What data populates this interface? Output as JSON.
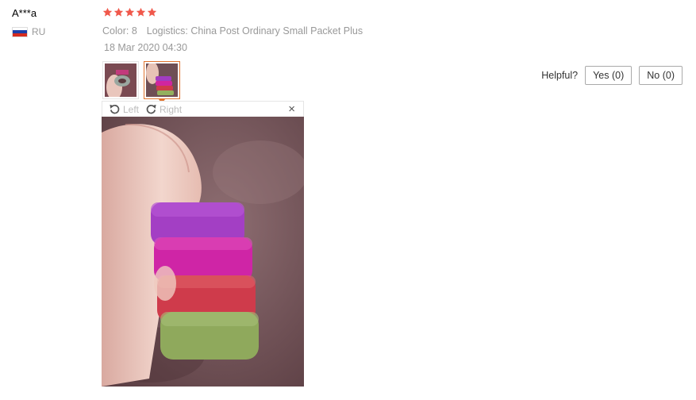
{
  "review": {
    "buyer_name": "A***a",
    "country": "RU",
    "rating": 5,
    "max_rating": 5,
    "color_label": "Color: 8",
    "logistics_label": "Logistics: China Post Ordinary Small Packet Plus",
    "date": "18 Mar 2020 04:30"
  },
  "viewer": {
    "rotate_left_label": "Left",
    "rotate_right_label": "Right",
    "close_symbol": "×"
  },
  "helpful": {
    "label": "Helpful?",
    "yes_label": "Yes (0)",
    "no_label": "No (0)"
  },
  "icons": {
    "star": "star-icon",
    "flag": "russia-flag-icon",
    "rotate_left": "rotate-left-icon",
    "rotate_right": "rotate-right-icon",
    "close": "close-icon"
  },
  "colors": {
    "star": "#f0584b",
    "active_thumb_border": "#e0742f",
    "muted_text": "#999999"
  }
}
